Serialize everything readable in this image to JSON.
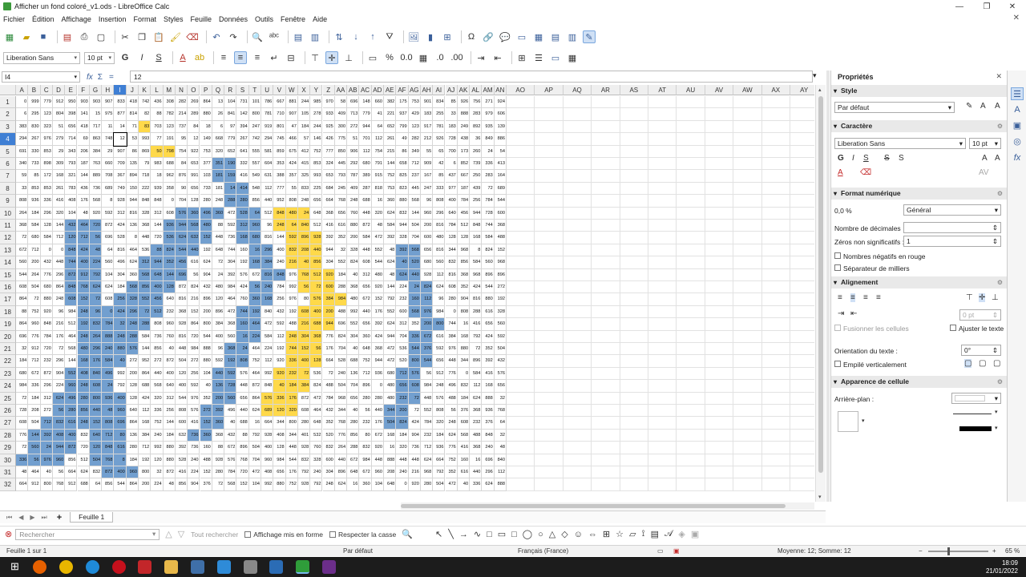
{
  "window": {
    "title": "Afficher un fond coloré_v1.ods - LibreOffice Calc",
    "min": "—",
    "max": "❐",
    "close": "✕"
  },
  "menu": [
    "Fichier",
    "Édition",
    "Affichage",
    "Insertion",
    "Format",
    "Styles",
    "Feuille",
    "Données",
    "Outils",
    "Fenêtre",
    "Aide"
  ],
  "format_toolbar": {
    "font_name": "Liberation Sans",
    "font_size": "10 pt"
  },
  "formula_bar": {
    "name_box": "I4",
    "fx": "fx",
    "sum": "Σ",
    "equals": "=",
    "content": "12"
  },
  "columns": [
    "A",
    "B",
    "C",
    "D",
    "E",
    "F",
    "G",
    "H",
    "I",
    "J",
    "K",
    "L",
    "M",
    "N",
    "O",
    "P",
    "Q",
    "R",
    "S",
    "T",
    "U",
    "V",
    "W",
    "X",
    "Y",
    "Z",
    "AA",
    "AB",
    "AC",
    "AD",
    "AE",
    "AF",
    "AG",
    "AH",
    "AI",
    "AJ",
    "AK",
    "AL",
    "AM",
    "AN",
    "AO",
    "AP",
    "AQ",
    "AR",
    "AS",
    "AT",
    "AU",
    "AV",
    "AW",
    "AX",
    "AY"
  ],
  "selected_column": "I",
  "rows": [
    "1",
    "2",
    "3",
    "4",
    "5",
    "6",
    "7",
    "8",
    "9",
    "10",
    "11",
    "12",
    "13",
    "14",
    "15",
    "16",
    "17",
    "18",
    "19",
    "20",
    "21",
    "22",
    "23",
    "24",
    "25",
    "26",
    "27",
    "28",
    "29",
    "30",
    "31",
    "32"
  ],
  "selected_row": "4",
  "cells_row1": [
    "0",
    "999",
    "779",
    "912",
    "950",
    "903",
    "903",
    "907",
    "833",
    "418",
    "742",
    "436",
    "308",
    "282",
    "269",
    "864",
    "13",
    "104",
    "731",
    "101",
    "786",
    "667",
    "881",
    "244",
    "985",
    "970",
    "58",
    "696",
    "148",
    "660",
    "382",
    "175",
    "753",
    "901",
    "834",
    "85",
    "926",
    "756",
    "271",
    "924"
  ],
  "cells_row2": [
    "6",
    "295",
    "123",
    "804",
    "398",
    "141",
    "15",
    "975",
    "877",
    "814",
    "82",
    "88",
    "782",
    "214",
    "289",
    "880",
    "26",
    "841",
    "142",
    "800",
    "781",
    "710",
    "907",
    "105",
    "278",
    "933",
    "409",
    "713",
    "779",
    "41",
    "221",
    "937",
    "429",
    "183",
    "255",
    "33",
    "888",
    "283",
    "979"
  ],
  "cells_row3": [
    "383",
    "830",
    "323",
    "51",
    "656",
    "418",
    "717",
    "11",
    "14",
    "71",
    "83",
    "703",
    "123",
    "737",
    "84",
    "18",
    "6",
    "97",
    "394",
    "247",
    "919",
    "801",
    "47",
    "184",
    "244",
    "925",
    "300",
    "272",
    "944",
    "64",
    "652",
    "799",
    "123",
    "917",
    "781",
    "183",
    "249",
    "892",
    "935",
    "139"
  ],
  "cells_row4": [
    "294",
    "267",
    "976",
    "279",
    "714",
    "69",
    "863",
    "748",
    "12",
    "53",
    "993",
    "77",
    "191",
    "95",
    "12",
    "149",
    "668",
    "779",
    "267",
    "742",
    "294",
    "745",
    "466",
    "57",
    "146",
    "426",
    "775",
    "51",
    "701",
    "112",
    "261",
    "49",
    "282",
    "212",
    "926",
    "728",
    "438",
    "36",
    "849",
    "886"
  ],
  "cells_row5": [
    "691",
    "330",
    "853",
    "29",
    "343",
    "206",
    "384",
    "29",
    "907",
    "86",
    "869",
    "50",
    "798",
    "754",
    "922",
    "753",
    "320",
    "652",
    "641",
    "555",
    "581",
    "859",
    "675",
    "412",
    "752",
    "777",
    "850",
    "906",
    "112",
    "754",
    "215",
    "86",
    "349",
    "55",
    "65",
    "700",
    "173",
    "260",
    "24",
    "54"
  ],
  "cells_row6": [
    "340",
    "733",
    "898",
    "309",
    "793",
    "187",
    "763",
    "660",
    "709",
    "135",
    "79",
    "983",
    "688",
    "84",
    "653",
    "377",
    "351",
    "190",
    "332",
    "557",
    "604",
    "353",
    "424",
    "415",
    "853",
    "324",
    "445",
    "292",
    "680",
    "791",
    "144",
    "658",
    "712",
    "909",
    "42",
    "6",
    "852",
    "739",
    "336",
    "413"
  ],
  "cells_row7": [
    "59",
    "85",
    "172",
    "168",
    "321",
    "144",
    "889",
    "708",
    "367",
    "894",
    "718",
    "18",
    "962",
    "876",
    "991",
    "103",
    "181",
    "159",
    "416",
    "549",
    "631",
    "388",
    "357",
    "325",
    "993",
    "653",
    "793",
    "787",
    "389",
    "915",
    "752",
    "825",
    "237",
    "167",
    "85",
    "437",
    "667",
    "250",
    "283",
    "164"
  ],
  "cells_row8": [
    "33",
    "853",
    "853",
    "261",
    "783",
    "436",
    "736",
    "689",
    "749",
    "150",
    "222",
    "939",
    "358",
    "90",
    "656",
    "733",
    "181",
    "14",
    "414",
    "548",
    "112",
    "777",
    "55",
    "833",
    "225",
    "684",
    "245",
    "409",
    "287",
    "818",
    "753",
    "823",
    "445",
    "247",
    "333",
    "977",
    "187",
    "439",
    "72",
    "689"
  ],
  "sidebar": {
    "title": "Propriétés",
    "style_header": "Style",
    "style_value": "Par défaut",
    "char_header": "Caractère",
    "char_font": "Liberation Sans",
    "char_size": "10 pt",
    "num_header": "Format numérique",
    "num_value": "Général",
    "num_glyphs": "0,0 %",
    "decimals_label": "Nombre de décimales",
    "zeros_label": "Zéros non significatifs :",
    "zeros_value": "1",
    "neg_red_label": "Nombres négatifs en rouge",
    "thousands_label": "Séparateur de milliers",
    "align_header": "Alignement",
    "indent_value": "0 pt",
    "merge_label": "Fusionner les cellules",
    "wrap_label": "Ajuster le texte",
    "orient_label": "Orientation du texte :",
    "orient_value": "0°",
    "stacked_label": "Empilé verticalement",
    "appearance_header": "Apparence de cellule",
    "bg_label": "Arrière-plan :",
    "more": "⚙"
  },
  "sheet": {
    "tab": "Feuille 1",
    "add": "+"
  },
  "find": {
    "placeholder": "Rechercher",
    "find_all": "Tout rechercher",
    "formatted": "Affichage mis en forme",
    "match_case": "Respecter la casse"
  },
  "status": {
    "sheet": "Feuille 1 sur 1",
    "style": "Par défaut",
    "lang": "Français (France)",
    "summary": "Moyenne: 12; Somme: 12",
    "zoom": "65 %"
  },
  "clock": {
    "time": "18:09",
    "date": "21/01/2022"
  },
  "colors": {
    "blue": "#729fcf",
    "yellow": "#ffd94a",
    "selection": "#3f7fd4"
  }
}
